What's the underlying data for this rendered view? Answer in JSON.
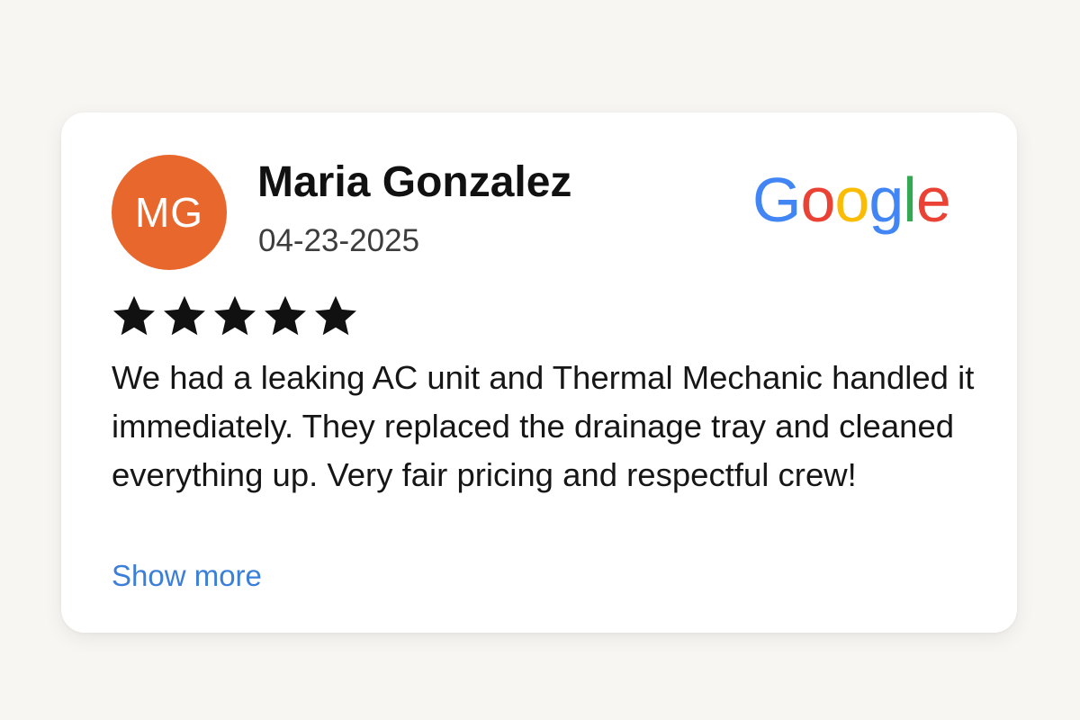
{
  "review": {
    "avatar_initials": "MG",
    "reviewer_name": "Maria Gonzalez",
    "date": "04-23-2025",
    "rating": 5,
    "rating_max": 5,
    "text": "We had a leaking AC unit and Thermal Mechanic handled it immediately. They replaced the drainage tray and cleaned everything up. Very fair pricing and respectful crew!",
    "show_more_label": "Show more",
    "source_logo": {
      "icon": "google-logo",
      "letters": [
        "G",
        "o",
        "o",
        "g",
        "l",
        "e"
      ]
    }
  },
  "colors": {
    "avatar": "#e8672c",
    "link": "#3b7fd8",
    "star": "#111111",
    "google_blue": "#4285F4",
    "google_red": "#EA4335",
    "google_yellow": "#FBBC05",
    "google_green": "#34A853"
  }
}
